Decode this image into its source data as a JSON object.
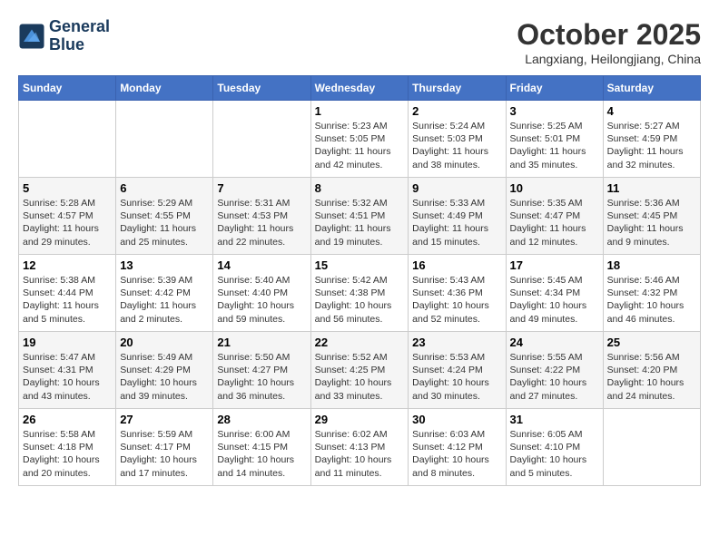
{
  "header": {
    "logo_line1": "General",
    "logo_line2": "Blue",
    "month": "October 2025",
    "location": "Langxiang, Heilongjiang, China"
  },
  "weekdays": [
    "Sunday",
    "Monday",
    "Tuesday",
    "Wednesday",
    "Thursday",
    "Friday",
    "Saturday"
  ],
  "weeks": [
    [
      {
        "day": "",
        "info": ""
      },
      {
        "day": "",
        "info": ""
      },
      {
        "day": "",
        "info": ""
      },
      {
        "day": "1",
        "info": "Sunrise: 5:23 AM\nSunset: 5:05 PM\nDaylight: 11 hours\nand 42 minutes."
      },
      {
        "day": "2",
        "info": "Sunrise: 5:24 AM\nSunset: 5:03 PM\nDaylight: 11 hours\nand 38 minutes."
      },
      {
        "day": "3",
        "info": "Sunrise: 5:25 AM\nSunset: 5:01 PM\nDaylight: 11 hours\nand 35 minutes."
      },
      {
        "day": "4",
        "info": "Sunrise: 5:27 AM\nSunset: 4:59 PM\nDaylight: 11 hours\nand 32 minutes."
      }
    ],
    [
      {
        "day": "5",
        "info": "Sunrise: 5:28 AM\nSunset: 4:57 PM\nDaylight: 11 hours\nand 29 minutes."
      },
      {
        "day": "6",
        "info": "Sunrise: 5:29 AM\nSunset: 4:55 PM\nDaylight: 11 hours\nand 25 minutes."
      },
      {
        "day": "7",
        "info": "Sunrise: 5:31 AM\nSunset: 4:53 PM\nDaylight: 11 hours\nand 22 minutes."
      },
      {
        "day": "8",
        "info": "Sunrise: 5:32 AM\nSunset: 4:51 PM\nDaylight: 11 hours\nand 19 minutes."
      },
      {
        "day": "9",
        "info": "Sunrise: 5:33 AM\nSunset: 4:49 PM\nDaylight: 11 hours\nand 15 minutes."
      },
      {
        "day": "10",
        "info": "Sunrise: 5:35 AM\nSunset: 4:47 PM\nDaylight: 11 hours\nand 12 minutes."
      },
      {
        "day": "11",
        "info": "Sunrise: 5:36 AM\nSunset: 4:45 PM\nDaylight: 11 hours\nand 9 minutes."
      }
    ],
    [
      {
        "day": "12",
        "info": "Sunrise: 5:38 AM\nSunset: 4:44 PM\nDaylight: 11 hours\nand 5 minutes."
      },
      {
        "day": "13",
        "info": "Sunrise: 5:39 AM\nSunset: 4:42 PM\nDaylight: 11 hours\nand 2 minutes."
      },
      {
        "day": "14",
        "info": "Sunrise: 5:40 AM\nSunset: 4:40 PM\nDaylight: 10 hours\nand 59 minutes."
      },
      {
        "day": "15",
        "info": "Sunrise: 5:42 AM\nSunset: 4:38 PM\nDaylight: 10 hours\nand 56 minutes."
      },
      {
        "day": "16",
        "info": "Sunrise: 5:43 AM\nSunset: 4:36 PM\nDaylight: 10 hours\nand 52 minutes."
      },
      {
        "day": "17",
        "info": "Sunrise: 5:45 AM\nSunset: 4:34 PM\nDaylight: 10 hours\nand 49 minutes."
      },
      {
        "day": "18",
        "info": "Sunrise: 5:46 AM\nSunset: 4:32 PM\nDaylight: 10 hours\nand 46 minutes."
      }
    ],
    [
      {
        "day": "19",
        "info": "Sunrise: 5:47 AM\nSunset: 4:31 PM\nDaylight: 10 hours\nand 43 minutes."
      },
      {
        "day": "20",
        "info": "Sunrise: 5:49 AM\nSunset: 4:29 PM\nDaylight: 10 hours\nand 39 minutes."
      },
      {
        "day": "21",
        "info": "Sunrise: 5:50 AM\nSunset: 4:27 PM\nDaylight: 10 hours\nand 36 minutes."
      },
      {
        "day": "22",
        "info": "Sunrise: 5:52 AM\nSunset: 4:25 PM\nDaylight: 10 hours\nand 33 minutes."
      },
      {
        "day": "23",
        "info": "Sunrise: 5:53 AM\nSunset: 4:24 PM\nDaylight: 10 hours\nand 30 minutes."
      },
      {
        "day": "24",
        "info": "Sunrise: 5:55 AM\nSunset: 4:22 PM\nDaylight: 10 hours\nand 27 minutes."
      },
      {
        "day": "25",
        "info": "Sunrise: 5:56 AM\nSunset: 4:20 PM\nDaylight: 10 hours\nand 24 minutes."
      }
    ],
    [
      {
        "day": "26",
        "info": "Sunrise: 5:58 AM\nSunset: 4:18 PM\nDaylight: 10 hours\nand 20 minutes."
      },
      {
        "day": "27",
        "info": "Sunrise: 5:59 AM\nSunset: 4:17 PM\nDaylight: 10 hours\nand 17 minutes."
      },
      {
        "day": "28",
        "info": "Sunrise: 6:00 AM\nSunset: 4:15 PM\nDaylight: 10 hours\nand 14 minutes."
      },
      {
        "day": "29",
        "info": "Sunrise: 6:02 AM\nSunset: 4:13 PM\nDaylight: 10 hours\nand 11 minutes."
      },
      {
        "day": "30",
        "info": "Sunrise: 6:03 AM\nSunset: 4:12 PM\nDaylight: 10 hours\nand 8 minutes."
      },
      {
        "day": "31",
        "info": "Sunrise: 6:05 AM\nSunset: 4:10 PM\nDaylight: 10 hours\nand 5 minutes."
      },
      {
        "day": "",
        "info": ""
      }
    ]
  ]
}
